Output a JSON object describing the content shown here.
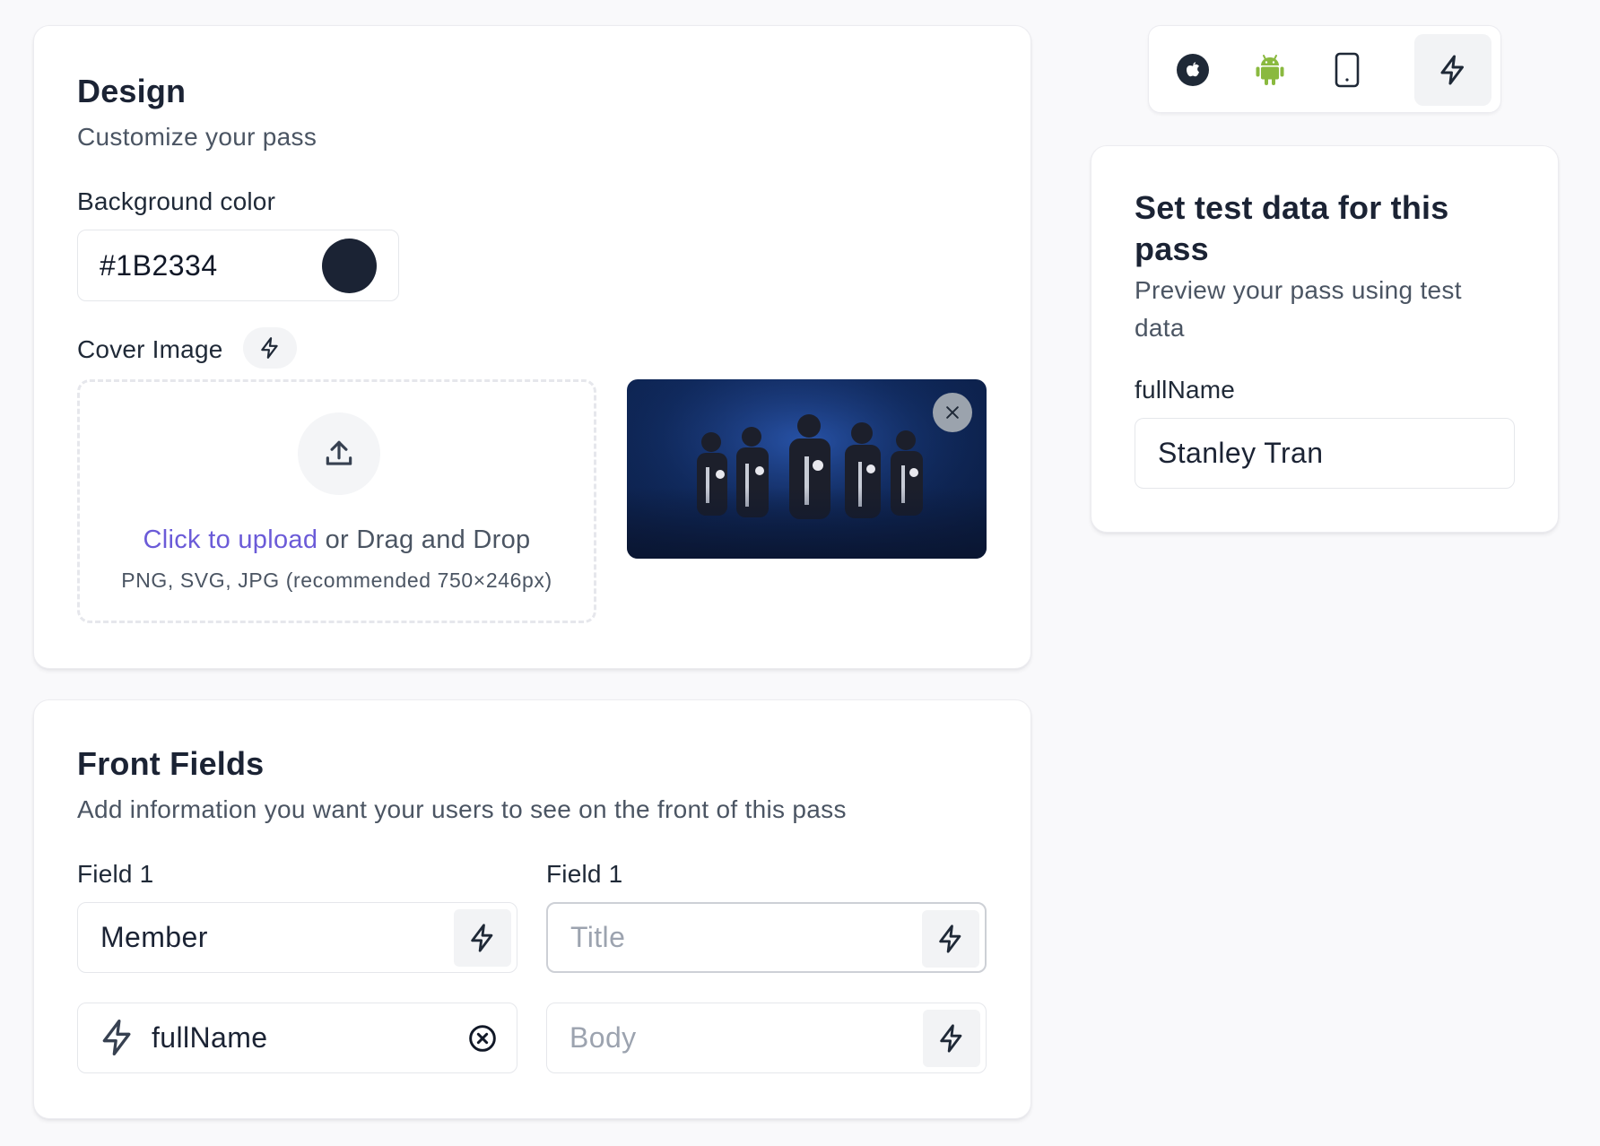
{
  "colors": {
    "background_swatch": "#1B2334",
    "accent_link": "#6b5bd8",
    "android_green": "#8ab93f"
  },
  "design": {
    "title": "Design",
    "subtitle": "Customize your pass",
    "background_color_label": "Background color",
    "background_color_value": "#1B2334",
    "cover_image_label": "Cover Image",
    "upload_link": "Click to upload",
    "upload_rest": " or Drag and Drop",
    "upload_hint": "PNG, SVG, JPG (recommended 750×246px)"
  },
  "front_fields": {
    "title": "Front Fields",
    "subtitle": "Add information you want your users to see on the front of this pass",
    "column1_label": "Field 1",
    "column2_label": "Field 1",
    "member_value": "Member",
    "title_placeholder": "Title",
    "fullname_value": "fullName",
    "body_placeholder": "Body"
  },
  "platforms": {
    "items": [
      "apple-icon",
      "android-icon",
      "tablet-icon",
      "bolt-icon"
    ],
    "active": "bolt-icon"
  },
  "test_data": {
    "title": "Set test data for this pass",
    "subtitle": "Preview your pass using test data",
    "field_label": "fullName",
    "field_value": "Stanley Tran"
  }
}
